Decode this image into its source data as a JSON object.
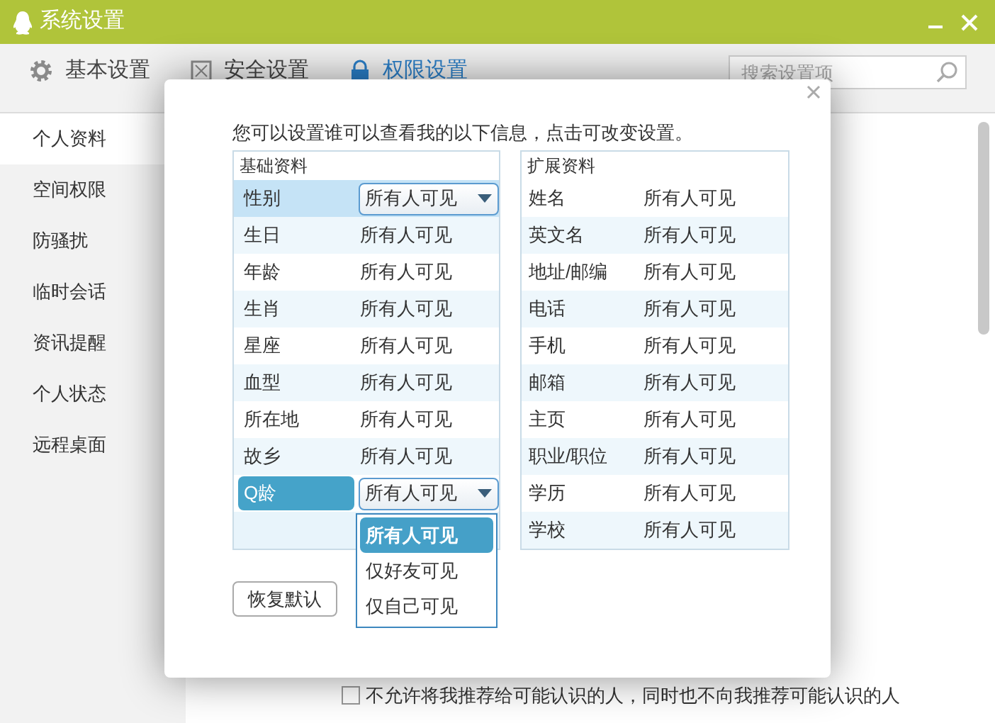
{
  "window": {
    "title": "系统设置"
  },
  "toolbar": {
    "tabs": [
      {
        "label": "基本设置",
        "selected": false,
        "kind": "gear"
      },
      {
        "label": "安全设置",
        "selected": false,
        "kind": "shield"
      },
      {
        "label": "权限设置",
        "selected": true,
        "kind": "lock"
      }
    ],
    "search": {
      "placeholder": "搜索设置项"
    }
  },
  "sidebar": {
    "items": [
      {
        "label": "个人资料",
        "selected": true
      },
      {
        "label": "空间权限",
        "selected": false
      },
      {
        "label": "防骚扰",
        "selected": false
      },
      {
        "label": "临时会话",
        "selected": false
      },
      {
        "label": "资讯提醒",
        "selected": false
      },
      {
        "label": "个人状态",
        "selected": false
      },
      {
        "label": "远程桌面",
        "selected": false
      }
    ]
  },
  "dialog": {
    "instruction": "您可以设置谁可以查看我的以下信息，点击可改变设置。",
    "basic": {
      "title": "基础资料",
      "rows": [
        {
          "label": "性别",
          "value": "所有人可见",
          "hovered": true,
          "selected": false,
          "expanded": false
        },
        {
          "label": "生日",
          "value": "所有人可见",
          "hovered": false,
          "selected": false,
          "expanded": false
        },
        {
          "label": "年龄",
          "value": "所有人可见",
          "hovered": false,
          "selected": false,
          "expanded": false
        },
        {
          "label": "生肖",
          "value": "所有人可见",
          "hovered": false,
          "selected": false,
          "expanded": false
        },
        {
          "label": "星座",
          "value": "所有人可见",
          "hovered": false,
          "selected": false,
          "expanded": false
        },
        {
          "label": "血型",
          "value": "所有人可见",
          "hovered": false,
          "selected": false,
          "expanded": false
        },
        {
          "label": "所在地",
          "value": "所有人可见",
          "hovered": false,
          "selected": false,
          "expanded": false
        },
        {
          "label": "故乡",
          "value": "所有人可见",
          "hovered": false,
          "selected": false,
          "expanded": false
        },
        {
          "label": "Q龄",
          "value": "所有人可见",
          "hovered": false,
          "selected": true,
          "expanded": true,
          "options": [
            {
              "label": "所有人可见",
              "selected": true
            },
            {
              "label": "仅好友可见",
              "selected": false
            },
            {
              "label": "仅自己可见",
              "selected": false
            }
          ]
        }
      ]
    },
    "extended": {
      "title": "扩展资料",
      "rows": [
        {
          "label": "姓名",
          "value": "所有人可见"
        },
        {
          "label": "英文名",
          "value": "所有人可见"
        },
        {
          "label": "地址/邮编",
          "value": "所有人可见"
        },
        {
          "label": "电话",
          "value": "所有人可见"
        },
        {
          "label": "手机",
          "value": "所有人可见"
        },
        {
          "label": "邮箱",
          "value": "所有人可见"
        },
        {
          "label": "主页",
          "value": "所有人可见"
        },
        {
          "label": "职业/职位",
          "value": "所有人可见"
        },
        {
          "label": "学历",
          "value": "所有人可见"
        },
        {
          "label": "学校",
          "value": "所有人可见"
        }
      ]
    },
    "restore_button": "恢复默认"
  },
  "footer": {
    "checkbox": {
      "label": "不允许将我推荐给可能认识的人，同时也不向我推荐可能认识的人",
      "checked": false
    }
  }
}
